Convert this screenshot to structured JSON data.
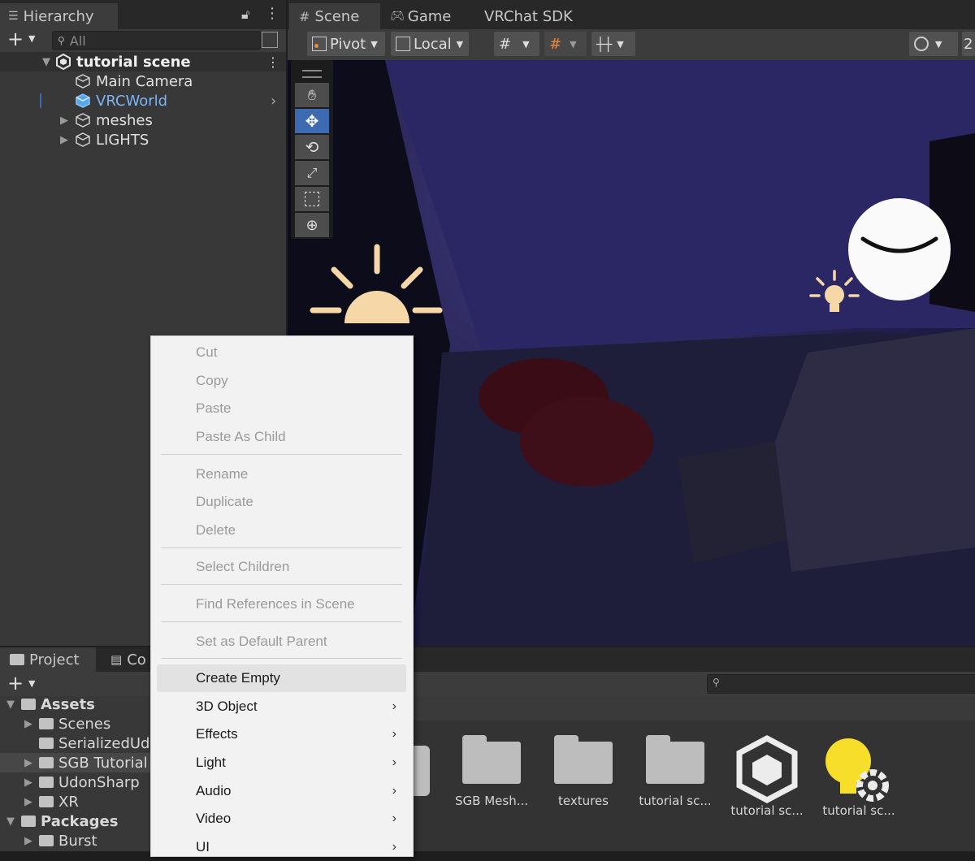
{
  "hierarchy": {
    "tab_label": "Hierarchy",
    "search_placeholder": "All",
    "scene_name": "tutorial scene",
    "items": [
      {
        "label": "Main Camera"
      },
      {
        "label": "VRCWorld"
      },
      {
        "label": "meshes"
      },
      {
        "label": "LIGHTS"
      }
    ]
  },
  "scene": {
    "tabs": [
      "Scene",
      "Game",
      "VRChat SDK"
    ],
    "toolbar": {
      "pivot": "Pivot",
      "local": "Local",
      "right_edge": "2"
    }
  },
  "project": {
    "tabs": [
      "Project",
      "Co"
    ],
    "tree": [
      {
        "label": "Assets"
      },
      {
        "label": "Scenes"
      },
      {
        "label": "SerializedUd"
      },
      {
        "label": "SGB Tutorial"
      },
      {
        "label": "UdonSharp"
      },
      {
        "label": "XR"
      },
      {
        "label": "Packages"
      },
      {
        "label": "Burst"
      }
    ],
    "assets": [
      {
        "label": "SGB Mesh..."
      },
      {
        "label": "textures"
      },
      {
        "label": "tutorial sc..."
      },
      {
        "label": "tutorial sc..."
      },
      {
        "label": "tutorial sc..."
      }
    ]
  },
  "context_menu": {
    "cut": "Cut",
    "copy": "Copy",
    "paste": "Paste",
    "paste_as_child": "Paste As Child",
    "rename": "Rename",
    "duplicate": "Duplicate",
    "delete": "Delete",
    "select_children": "Select Children",
    "find_references": "Find References in Scene",
    "set_default_parent": "Set as Default Parent",
    "create_empty": "Create Empty",
    "object_3d": "3D Object",
    "effects": "Effects",
    "light": "Light",
    "audio": "Audio",
    "video": "Video",
    "ui": "UI"
  },
  "colors": {
    "selection_text": "#7cb4f5",
    "accent": "#3d6ab0",
    "sun": "#f6d7a8",
    "bulb": "#f7de2a"
  }
}
